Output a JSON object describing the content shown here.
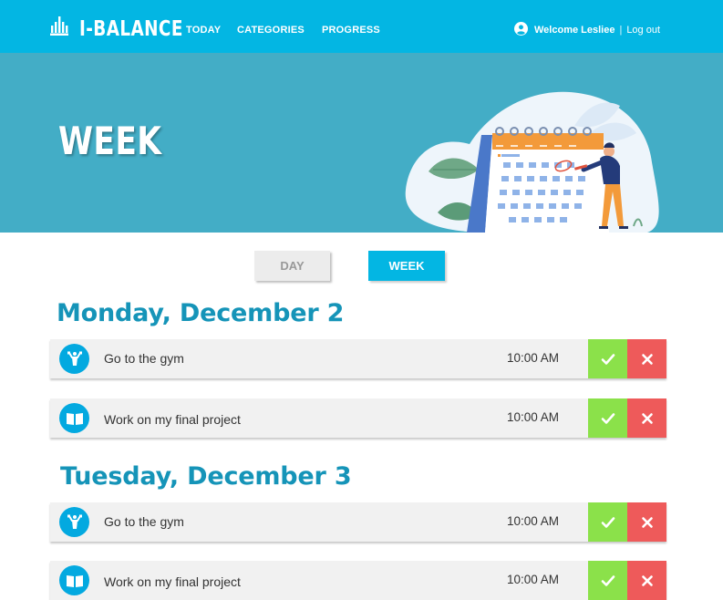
{
  "app": {
    "logo_text": "I-BALANCE",
    "logo_icon": "balance-bars-icon"
  },
  "nav": {
    "today": "TODAY",
    "categories": "CATEGORIES",
    "progress": "PROGRESS"
  },
  "user": {
    "icon": "user-circle-icon",
    "welcome": "Welcome Lesliee",
    "separator": "|",
    "logout": "Log out"
  },
  "hero": {
    "title": "WEEK",
    "illustration": "calendar-person-illustration"
  },
  "view_toggle": {
    "day": "DAY",
    "week": "WEEK",
    "active": "WEEK"
  },
  "colors": {
    "header": "#03b6e3",
    "hero": "#43adc6",
    "heading": "#1594b8",
    "done": "#8be14a",
    "cancel": "#ee5a5a"
  },
  "days": [
    {
      "heading": "Monday, December 2",
      "tasks": [
        {
          "icon": "fitness-person-icon",
          "title": "Go to the gym",
          "time": "10:00 AM"
        },
        {
          "icon": "open-book-icon",
          "title": "Work on my final project",
          "time": "10:00 AM"
        }
      ]
    },
    {
      "heading": "Tuesday, December 3",
      "tasks": [
        {
          "icon": "fitness-person-icon",
          "title": "Go to the gym",
          "time": "10:00 AM"
        },
        {
          "icon": "open-book-icon",
          "title": "Work on my final project",
          "time": "10:00 AM"
        }
      ]
    }
  ]
}
